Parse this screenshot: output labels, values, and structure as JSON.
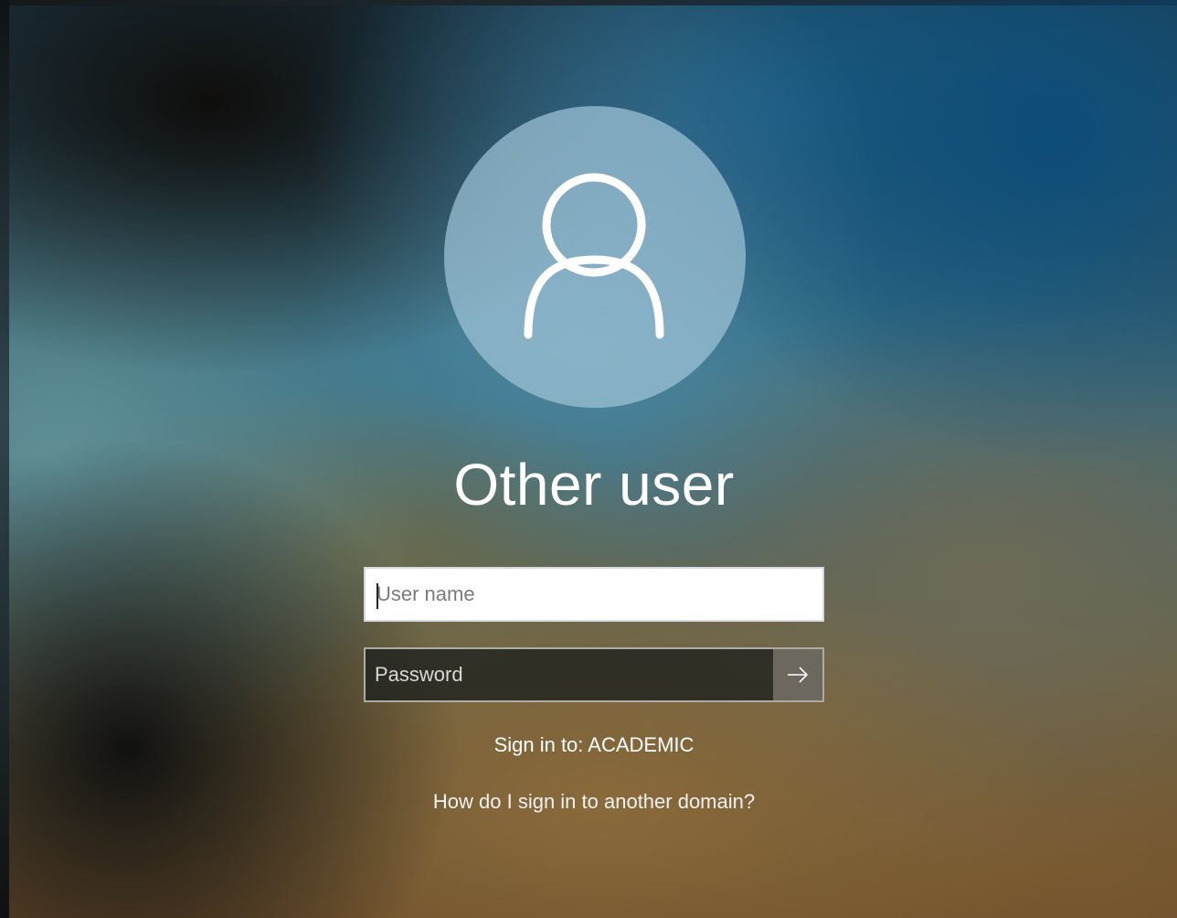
{
  "login": {
    "title": "Other user",
    "username_field": {
      "placeholder": "User name",
      "value": ""
    },
    "password_field": {
      "placeholder": "Password",
      "value": ""
    },
    "sign_in_to": "Sign in to: ACADEMIC",
    "other_domain_link": "How do I sign in to another domain?"
  },
  "icons": {
    "avatar": "user-icon",
    "submit": "arrow-right-icon"
  },
  "colors": {
    "avatar_circle": "#a0c3d7",
    "text": "#ffffff",
    "input_background": "#ffffff",
    "password_background": "#1c201e"
  }
}
